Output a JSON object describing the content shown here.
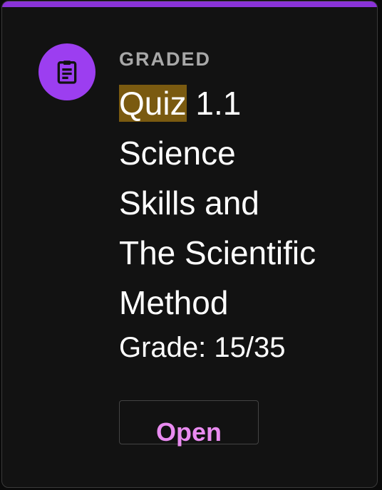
{
  "card": {
    "accent_color": "#8a33d8",
    "icon": "clipboard-icon",
    "icon_bg_color": "#9c3ef0",
    "category": "GRADED",
    "title_highlight": "Quiz",
    "title_rest_line1": " 1.1",
    "title_line2": "Science",
    "title_line3": "Skills and",
    "title_line4": "The Scientific",
    "title_line5": "Method",
    "grade": "Grade: 15/35",
    "open_label": "Open",
    "highlight_color": "#7a5a10",
    "button_text_color": "#e98bf0"
  }
}
